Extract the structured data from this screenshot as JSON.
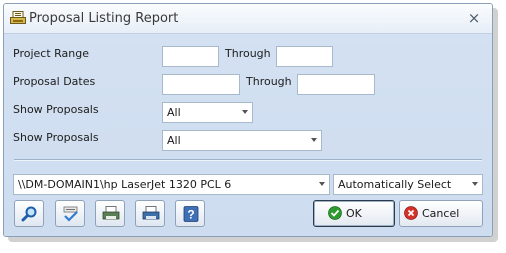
{
  "window": {
    "title": "Proposal Listing Report",
    "close_glyph": "×"
  },
  "form": {
    "project_range_label": "Project Range",
    "project_range_through_label": "Through",
    "project_range_from": "",
    "project_range_to": "",
    "proposal_dates_label": "Proposal Dates",
    "proposal_dates_through_label": "Through",
    "proposal_dates_from": "",
    "proposal_dates_to": "",
    "show_proposals_1_label": "Show Proposals",
    "show_proposals_1_value": "All",
    "show_proposals_2_label": "Show Proposals",
    "show_proposals_2_value": "All"
  },
  "printer": {
    "device": "\\\\DM-DOMAIN1\\hp LaserJet 1320 PCL 6",
    "tray": "Automatically Select"
  },
  "toolbar": {
    "icons": [
      "magnifier-icon",
      "spell-check-icon",
      "print-preview-icon",
      "printer-icon",
      "help-icon"
    ],
    "help_glyph": "?"
  },
  "actions": {
    "ok_label": "OK",
    "cancel_label": "Cancel"
  },
  "colors": {
    "body_bg": "#cfdef0",
    "ok_icon": "#2f9a2f",
    "cancel_icon": "#d3312a"
  }
}
